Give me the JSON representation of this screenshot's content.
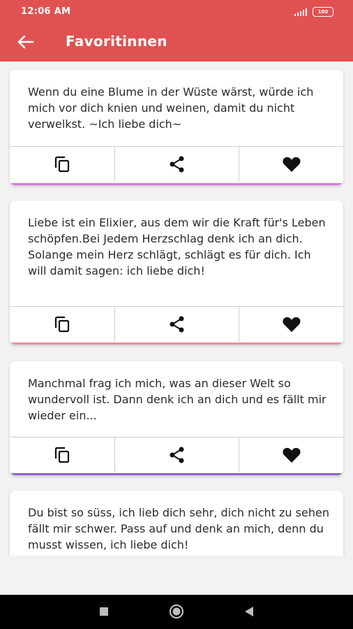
{
  "status_bar": {
    "time": "12:06 AM",
    "battery": "100"
  },
  "toolbar": {
    "title": "Favoritinnen",
    "back_icon": "arrow-left-icon"
  },
  "theme": {
    "app_bar_color": "#e05252",
    "background": "#f2f2f2"
  },
  "cards": [
    {
      "text": "Wenn du eine Blume in der Wüste wärst, würde ich mich vor dich knien und weinen, damit du nicht verwelkst. ~Ich liebe dich~",
      "accent_color": "#d77ad9"
    },
    {
      "text": "Liebe ist ein Elixier, aus dem wir die Kraft für's Leben schöpfen.Bei Jedem Herzschlag denk ich an dich. Solange mein Herz schlägt, schlägt es für dich. Ich will damit sagen: ich liebe dich!",
      "accent_color": "#ec8f97"
    },
    {
      "text": "Manchmal frag ich mich, was an dieser Welt so wundervoll ist. Dann denk ich an dich und es fällt mir wieder ein...",
      "accent_color": "#8e63c9"
    },
    {
      "text": "Du bist so süss, ich lieb dich sehr, dich nicht zu sehen fällt mir schwer. Pass auf und denk an mich, denn du musst wissen, ich liebe dich!",
      "accent_color": ""
    }
  ],
  "card_actions": {
    "copy_icon": "copy-icon",
    "share_icon": "share-icon",
    "favorite_icon": "heart-icon"
  },
  "nav_bar": {
    "recents_icon": "square-icon",
    "home_icon": "circle-icon",
    "back_icon": "triangle-back-icon"
  }
}
